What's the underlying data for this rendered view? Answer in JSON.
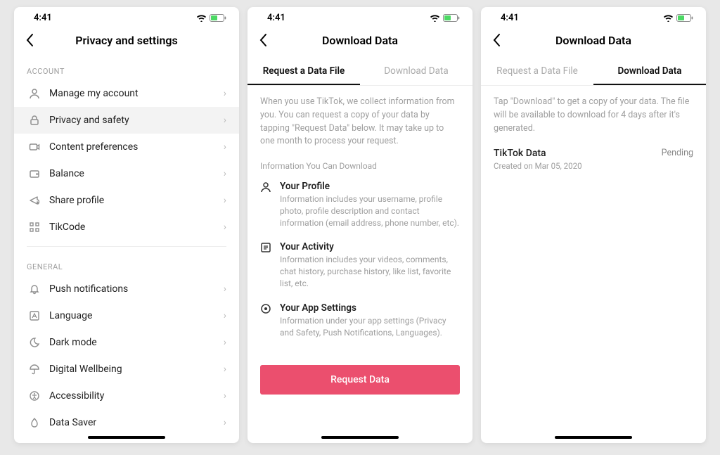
{
  "status": {
    "time": "4:41"
  },
  "screen1": {
    "title": "Privacy and settings",
    "sections": {
      "account_label": "ACCOUNT",
      "account_items": [
        {
          "label": "Manage my account",
          "icon": "person"
        },
        {
          "label": "Privacy and safety",
          "icon": "lock",
          "selected": true
        },
        {
          "label": "Content preferences",
          "icon": "video"
        },
        {
          "label": "Balance",
          "icon": "wallet"
        },
        {
          "label": "Share profile",
          "icon": "share"
        },
        {
          "label": "TikCode",
          "icon": "qr"
        }
      ],
      "general_label": "GENERAL",
      "general_items": [
        {
          "label": "Push notifications",
          "icon": "bell"
        },
        {
          "label": "Language",
          "icon": "lang"
        },
        {
          "label": "Dark mode",
          "icon": "moon"
        },
        {
          "label": "Digital Wellbeing",
          "icon": "umbrella"
        },
        {
          "label": "Accessibility",
          "icon": "accessibility"
        },
        {
          "label": "Data Saver",
          "icon": "drop"
        }
      ]
    }
  },
  "screen2": {
    "title": "Download Data",
    "tabs": {
      "request": "Request a Data File",
      "download": "Download Data"
    },
    "intro": "When you use TikTok, we collect information from you. You can request a copy of your data by tapping \"Request Data\" below. It may take up to one month to process your request.",
    "info_label": "Information You Can Download",
    "items": [
      {
        "title": "Your Profile",
        "desc": "Information includes your username, profile photo, profile description and contact information (email address, phone number, etc)."
      },
      {
        "title": "Your Activity",
        "desc": "Information includes your videos, comments, chat history, purchase history, like list, favorite list, etc."
      },
      {
        "title": "Your App Settings",
        "desc": "Information under your app settings (Privacy and Safety, Push Notifications, Languages)."
      }
    ],
    "button": "Request Data"
  },
  "screen3": {
    "title": "Download Data",
    "tabs": {
      "request": "Request a Data File",
      "download": "Download Data"
    },
    "intro": "Tap \"Download\" to get a copy of your data. The file will be available to download for 4 days after it's generated.",
    "file": {
      "title": "TikTok Data",
      "sub": "Created on Mar 05, 2020",
      "status": "Pending"
    }
  }
}
